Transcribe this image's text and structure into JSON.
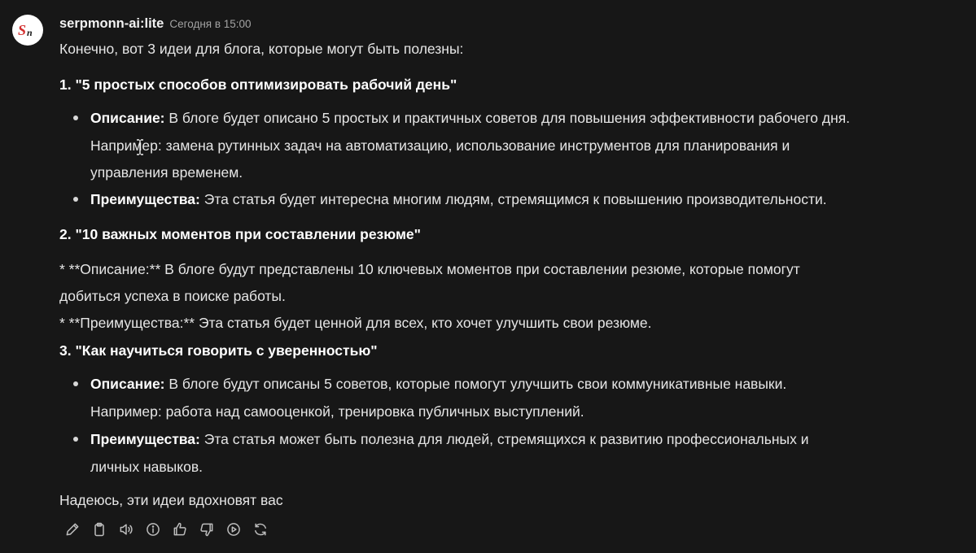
{
  "message": {
    "author": "serpmonn-ai:lite",
    "time": "Сегодня в 15:00",
    "avatar_text": "Sn",
    "intro": "Конечно, вот 3 идеи для блога, которые могут быть полезны:",
    "idea1": {
      "title": "1. \"5 простых способов оптимизировать рабочий день\"",
      "desc_label": "Описание:",
      "desc_line1": " В блоге будет описано 5 простых и практичных советов для повышения эффективности рабочего дня.",
      "desc_line2": "Например: замена рутинных задач на автоматизацию, использование инструментов для планирования и",
      "desc_line3": "управления временем.",
      "adv_label": "Преимущества:",
      "adv_line1": " Эта статья будет интересна многим людям, стремящимся к повышению производительности."
    },
    "idea2": {
      "title": "2. \"10 важных моментов при составлении резюме\"",
      "raw_line1": "* **Описание:** В блоге будут представлены 10 ключевых моментов при составлении резюме, которые помогут",
      "raw_line2": "добиться успеха в поиске работы.",
      "raw_line3": "* **Преимущества:** Эта статья будет ценной для всех, кто хочет улучшить свои резюме."
    },
    "idea3": {
      "title": "3. \"Как научиться говорить с уверенностью\"",
      "desc_label": "Описание:",
      "desc_line1": " В блоге будут описаны 5 советов, которые помогут улучшить свои коммуникативные навыки.",
      "desc_line2": "Например: работа над самооценкой, тренировка публичных выступлений.",
      "adv_label": "Преимущества:",
      "adv_line1": " Эта статья может быть полезна для людей, стремящихся к развитию профессиональных и",
      "adv_line2": "личных навыков."
    },
    "closing": "Надеюсь, эти идеи вдохновят вас"
  },
  "actions": [
    "edit-icon",
    "copy-icon",
    "speaker-icon",
    "info-icon",
    "thumbs-up-icon",
    "thumbs-down-icon",
    "play-icon",
    "regenerate-icon"
  ],
  "colors": {
    "background": "#171717",
    "text": "#e6e6e6",
    "muted": "#a3a3a3",
    "avatar_bg": "#ffffff",
    "avatar_accent": "#d32f2f"
  }
}
